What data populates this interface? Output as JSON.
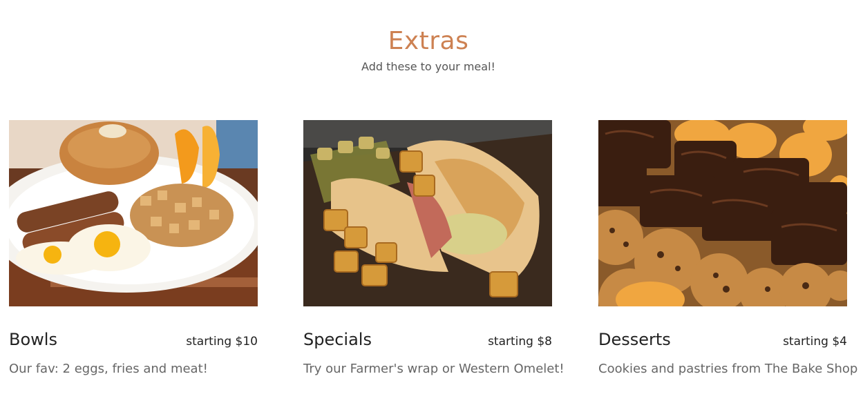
{
  "header": {
    "title": "Extras",
    "subtitle": "Add these to your meal!"
  },
  "cards": [
    {
      "name": "Bowls",
      "price": "starting $10",
      "description": "Our fav: 2 eggs, fries and meat!",
      "image": "breakfast-plate-photo"
    },
    {
      "name": "Specials",
      "price": "starting $8",
      "description": "Try our Farmer's wrap or Western Omelet!",
      "image": "breakfast-wrap-photo"
    },
    {
      "name": "Desserts",
      "price": "starting $4",
      "description": "Cookies and pastries from The Bake Shop",
      "image": "cookies-brownies-photo"
    }
  ],
  "colors": {
    "accent": "#cd8152",
    "text": "#222222",
    "muted": "#666666"
  }
}
